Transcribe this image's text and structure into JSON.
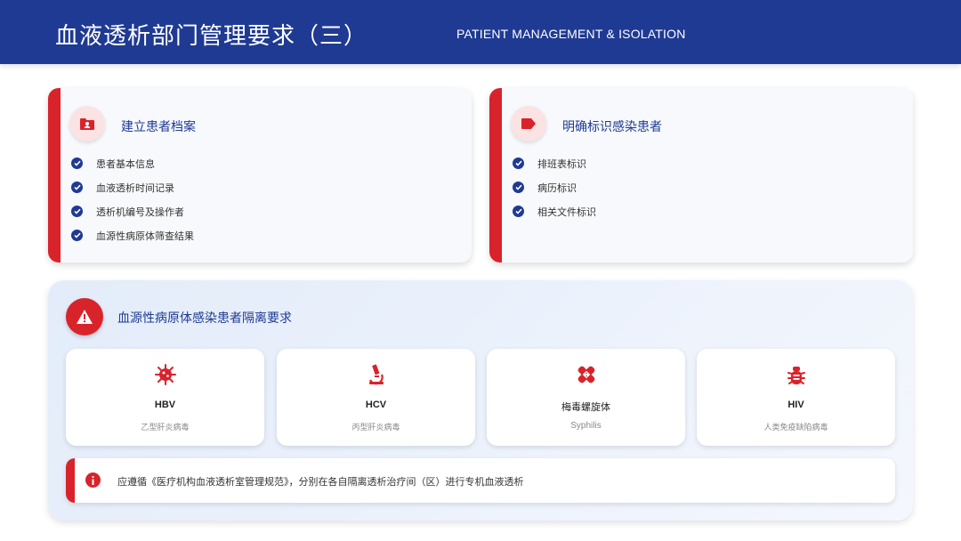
{
  "header": {
    "title": "血液透析部门管理要求（三）",
    "subtitle": "PATIENT MANAGEMENT & ISOLATION"
  },
  "cards": [
    {
      "title": "建立患者档案",
      "icon": "id-card-icon",
      "items": [
        "患者基本信息",
        "血液透析时间记录",
        "透析机编号及操作者",
        "血源性病原体筛查结果"
      ]
    },
    {
      "title": "明确标识感染患者",
      "icon": "tag-icon",
      "items": [
        "排班表标识",
        "病历标识",
        "相关文件标识"
      ]
    }
  ],
  "isolation": {
    "title": "血源性病原体感染患者隔离要求",
    "icon": "warning-icon",
    "pathogens": [
      {
        "name": "HBV",
        "desc": "乙型肝炎病毒",
        "icon": "virus-icon"
      },
      {
        "name": "HCV",
        "desc": "丙型肝炎病毒",
        "icon": "microscope-icon"
      },
      {
        "name": "梅毒螺旋体",
        "desc": "Syphilis",
        "icon": "bandage-icon"
      },
      {
        "name": "HIV",
        "desc": "人类免疫缺陷病毒",
        "icon": "bug-icon"
      }
    ],
    "note": "应遵循《医疗机构血液透析室管理规范》，分别在各自隔离透析治疗间（区）进行专机血液透析"
  },
  "colors": {
    "primary": "#1f3a93",
    "accent": "#d9232b",
    "card_bg": "#f7f9fc",
    "icon_circle_bg": "#fbe3e4"
  }
}
